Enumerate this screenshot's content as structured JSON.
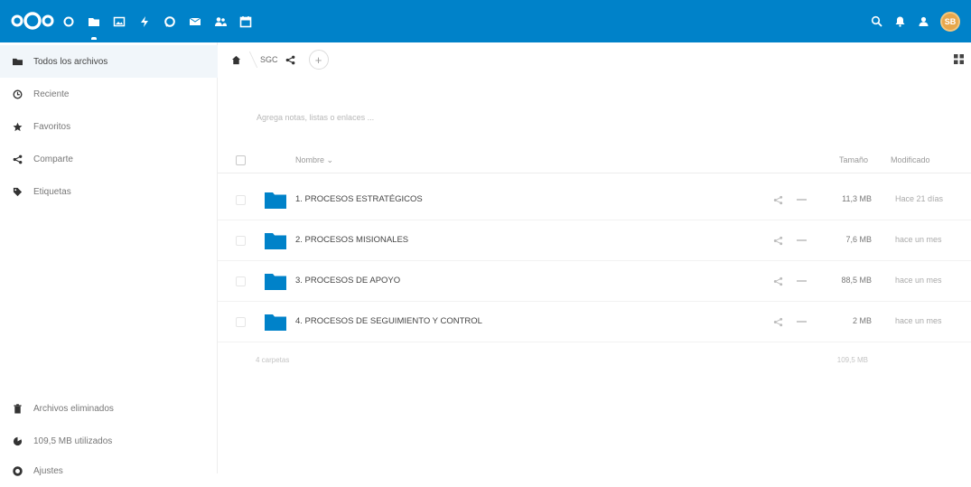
{
  "header": {
    "brand": "Nextcloud",
    "brand_color": "#0082c9",
    "apps": [
      {
        "icon": "dashboard-icon"
      },
      {
        "icon": "folder-icon",
        "active": true
      },
      {
        "icon": "photos-icon"
      },
      {
        "icon": "activity-icon"
      },
      {
        "icon": "talk-icon"
      },
      {
        "icon": "mail-icon"
      },
      {
        "icon": "contacts-icon"
      },
      {
        "icon": "calendar-icon"
      }
    ],
    "right_icons": [
      "search-icon",
      "notifications-icon",
      "contacts-menu-icon"
    ],
    "avatar_initials": "SB",
    "avatar_color": "#e8a74c"
  },
  "sidebar": {
    "items": [
      {
        "label": "Todos los archivos",
        "icon": "folder-icon",
        "active": true
      },
      {
        "label": "Reciente",
        "icon": "clock-icon"
      },
      {
        "label": "Favoritos",
        "icon": "star-icon"
      },
      {
        "label": "Comparte",
        "icon": "share-icon"
      },
      {
        "label": "Etiquetas",
        "icon": "tag-icon"
      }
    ],
    "bottom": [
      {
        "label": "Archivos eliminados",
        "icon": "trash-icon"
      },
      {
        "label": "109,5 MB utilizados",
        "icon": "pie-chart-icon"
      },
      {
        "label": "Ajustes",
        "icon": "settings-icon"
      }
    ]
  },
  "breadcrumb": {
    "home_icon": "home-icon",
    "folder": "SGC",
    "add_label": "+"
  },
  "notes_placeholder": "Agrega notas, listas o enlaces ...",
  "table": {
    "headers": {
      "name": "Nombre ⌄",
      "size": "Tamaño",
      "modified": "Modificado"
    },
    "rows": [
      {
        "name": "1. PROCESOS ESTRATÉGICOS",
        "size": "11,3 MB",
        "modified": "Hace 21 días"
      },
      {
        "name": "2. PROCESOS MISIONALES",
        "size": "7,6 MB",
        "modified": "hace un mes"
      },
      {
        "name": "3. PROCESOS DE APOYO",
        "size": "88,5 MB",
        "modified": "hace un mes"
      },
      {
        "name": "4. PROCESOS DE SEGUIMIENTO Y CONTROL",
        "size": "2 MB",
        "modified": "hace un mes"
      }
    ],
    "summary": "4 carpetas",
    "summary_size": "109,5 MB"
  },
  "colors": {
    "folder": "#0082c9",
    "active_bg": "#f1f6fa"
  }
}
